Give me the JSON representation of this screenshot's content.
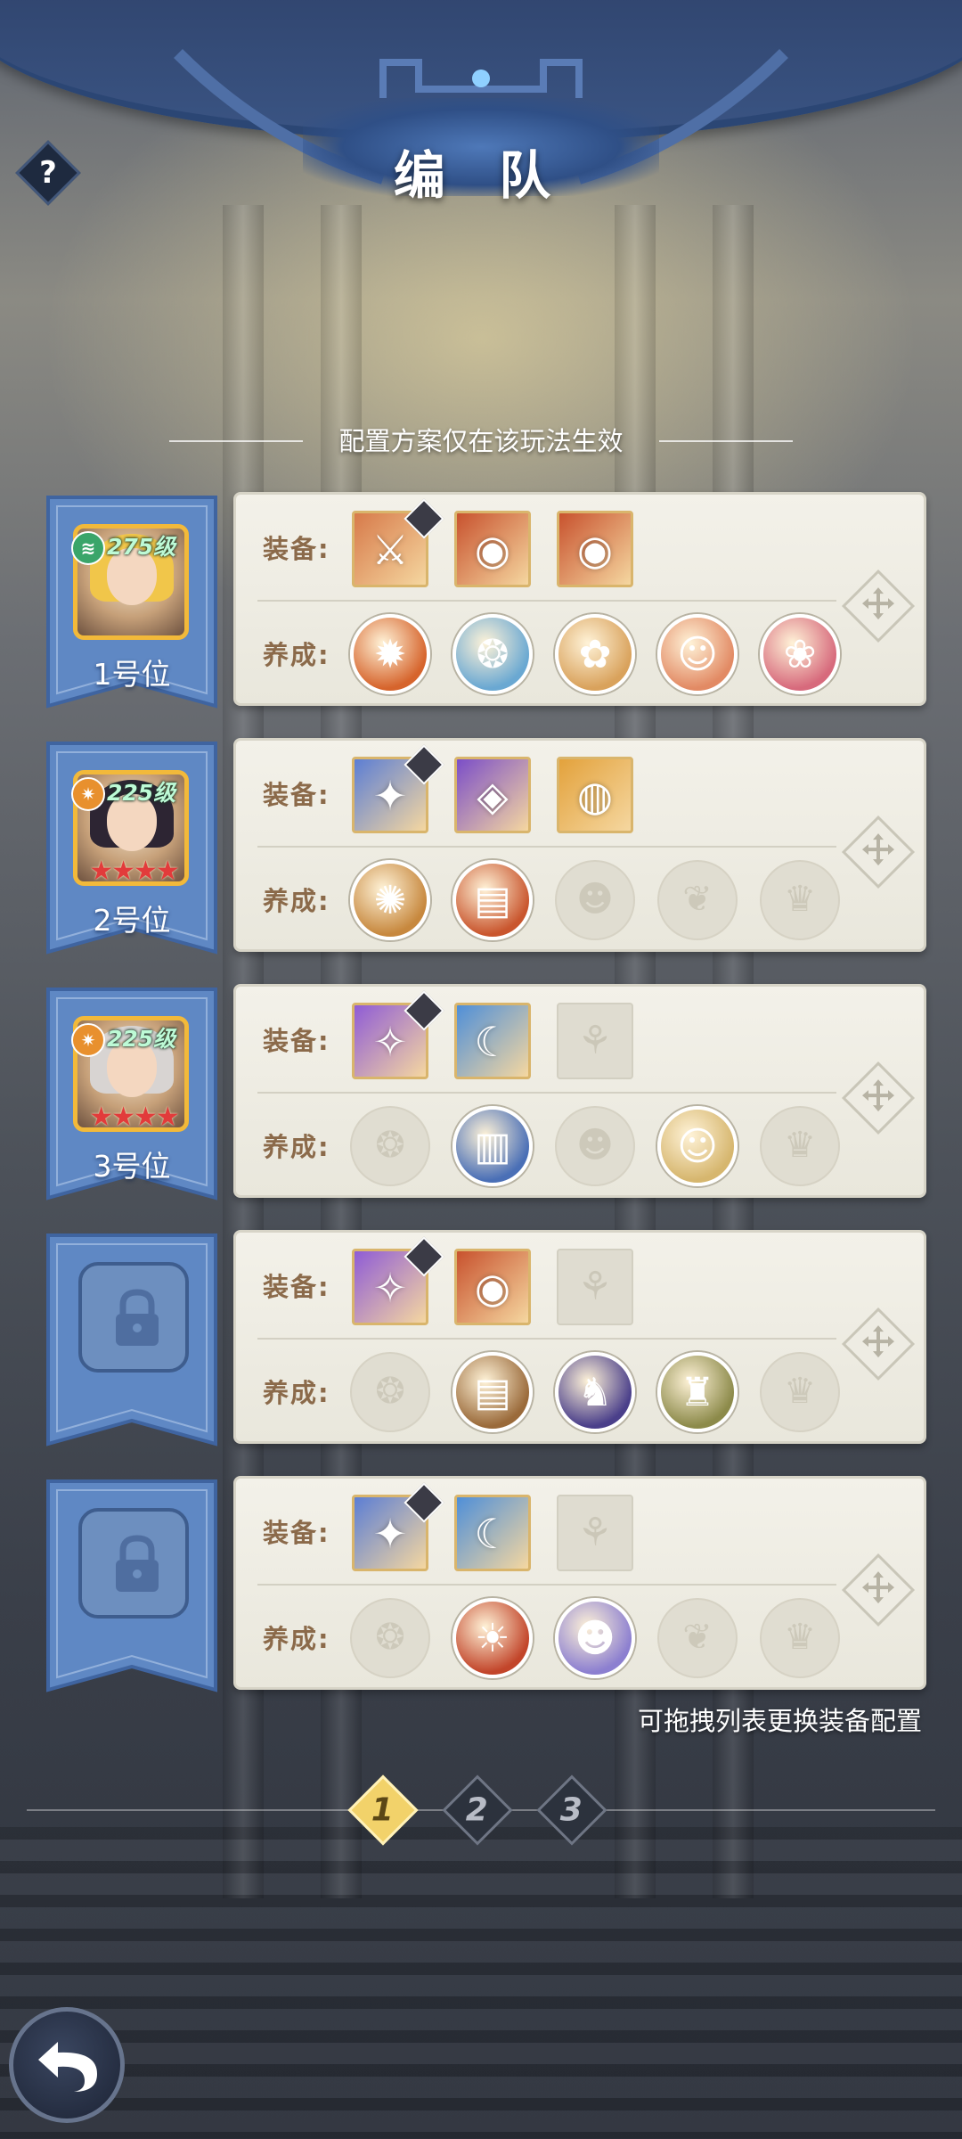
{
  "header": {
    "title": "编 队",
    "help_label": "?"
  },
  "notice": "配置方案仅在该玩法生效",
  "labels": {
    "equip": "装备:",
    "train": "养成:"
  },
  "rows": [
    {
      "slot_label": "1号位",
      "locked": false,
      "level": "275级",
      "level_icon": "green-wing-icon",
      "stars": "",
      "portrait_hair": "#f1c64a",
      "equip": [
        {
          "state": "filled",
          "icon": "golden-sword-icon",
          "glyph": "⚔",
          "color": "#d77a4a",
          "weapon": true
        },
        {
          "state": "filled",
          "icon": "red-amulet-icon",
          "glyph": "◉",
          "color": "#c8522e",
          "weapon": false
        },
        {
          "state": "filled",
          "icon": "red-amulet-icon",
          "glyph": "◉",
          "color": "#c8522e",
          "weapon": false
        }
      ],
      "train": [
        {
          "state": "filled",
          "icon": "fire-pet-icon",
          "glyph": "✹",
          "color": "#d6642c"
        },
        {
          "state": "filled",
          "icon": "water-pet-icon",
          "glyph": "❂",
          "color": "#6aa8d2"
        },
        {
          "state": "filled",
          "icon": "cat-pet-icon",
          "glyph": "✿",
          "color": "#d9a25c"
        },
        {
          "state": "filled",
          "icon": "orange-hair-girl-icon",
          "glyph": "☺",
          "color": "#e28a64"
        },
        {
          "state": "filled",
          "icon": "pink-spirit-icon",
          "glyph": "❀",
          "color": "#d76a7c"
        }
      ]
    },
    {
      "slot_label": "2号位",
      "locked": false,
      "level": "225级",
      "level_icon": "orange-sun-icon",
      "stars": "★★★★",
      "portrait_hair": "#2d2533",
      "equip": [
        {
          "state": "filled",
          "icon": "crystal-sword-icon",
          "glyph": "✦",
          "color": "#5c7ed4",
          "weapon": true
        },
        {
          "state": "filled",
          "icon": "purple-amulet-icon",
          "glyph": "◈",
          "color": "#7b4ec8",
          "weapon": false
        },
        {
          "state": "filled",
          "icon": "gold-amulet-icon",
          "glyph": "◍",
          "color": "#e3a23c",
          "weapon": false
        }
      ],
      "train": [
        {
          "state": "filled",
          "icon": "rune-disc-icon",
          "glyph": "✺",
          "color": "#c7883e"
        },
        {
          "state": "filled",
          "icon": "book-icon",
          "glyph": "▤",
          "color": "#c9562e"
        },
        {
          "state": "empty",
          "icon": "cat-slot-icon",
          "glyph": "☻",
          "color": ""
        },
        {
          "state": "empty",
          "icon": "flower-slot-icon",
          "glyph": "❦",
          "color": ""
        },
        {
          "state": "empty",
          "icon": "crest-slot-icon",
          "glyph": "♛",
          "color": ""
        }
      ]
    },
    {
      "slot_label": "3号位",
      "locked": false,
      "level": "225级",
      "level_icon": "orange-sun-icon",
      "stars": "★★★★",
      "portrait_hair": "#d8d4d2",
      "equip": [
        {
          "state": "filled",
          "icon": "wing-sword-icon",
          "glyph": "✧",
          "color": "#8f5cd6",
          "weapon": true
        },
        {
          "state": "filled",
          "icon": "moon-amulet-icon",
          "glyph": "☾",
          "color": "#4f8fd8",
          "weapon": false
        },
        {
          "state": "empty",
          "icon": "amulet-slot-icon",
          "glyph": "⚘",
          "color": "",
          "weapon": false
        }
      ],
      "train": [
        {
          "state": "empty",
          "icon": "disc-slot-icon",
          "glyph": "❂",
          "color": ""
        },
        {
          "state": "filled",
          "icon": "blue-book-icon",
          "glyph": "▥",
          "color": "#4a6fb6"
        },
        {
          "state": "empty",
          "icon": "cat-slot-icon",
          "glyph": "☻",
          "color": ""
        },
        {
          "state": "filled",
          "icon": "golden-hair-girl-icon",
          "glyph": "☺",
          "color": "#d6b66e"
        },
        {
          "state": "empty",
          "icon": "crest-slot-icon",
          "glyph": "♛",
          "color": ""
        }
      ]
    },
    {
      "slot_label": "",
      "locked": true,
      "level": "",
      "level_icon": "",
      "stars": "",
      "portrait_hair": "",
      "equip": [
        {
          "state": "filled",
          "icon": "wing-sword-icon",
          "glyph": "✧",
          "color": "#8f5cd6",
          "weapon": true
        },
        {
          "state": "filled",
          "icon": "red-amulet-icon",
          "glyph": "◉",
          "color": "#c8522e",
          "weapon": false
        },
        {
          "state": "empty",
          "icon": "amulet-slot-icon",
          "glyph": "⚘",
          "color": "",
          "weapon": false
        }
      ],
      "train": [
        {
          "state": "empty",
          "icon": "disc-slot-icon",
          "glyph": "❂",
          "color": ""
        },
        {
          "state": "filled",
          "icon": "brown-book-icon",
          "glyph": "▤",
          "color": "#9a6a3a"
        },
        {
          "state": "filled",
          "icon": "dark-knight-icon",
          "glyph": "♞",
          "color": "#4a3f8a"
        },
        {
          "state": "filled",
          "icon": "dragon-icon",
          "glyph": "♜",
          "color": "#8c8a4a"
        },
        {
          "state": "empty",
          "icon": "crest-slot-icon",
          "glyph": "♛",
          "color": ""
        }
      ]
    },
    {
      "slot_label": "",
      "locked": true,
      "level": "",
      "level_icon": "",
      "stars": "",
      "portrait_hair": "",
      "equip": [
        {
          "state": "filled",
          "icon": "crystal-sword-icon",
          "glyph": "✦",
          "color": "#5c7ed4",
          "weapon": true
        },
        {
          "state": "filled",
          "icon": "moon-amulet-icon",
          "glyph": "☾",
          "color": "#4f8fd8",
          "weapon": false
        },
        {
          "state": "empty",
          "icon": "amulet-slot-icon",
          "glyph": "⚘",
          "color": "",
          "weapon": false
        }
      ],
      "train": [
        {
          "state": "empty",
          "icon": "disc-slot-icon",
          "glyph": "❂",
          "color": ""
        },
        {
          "state": "filled",
          "icon": "sun-book-icon",
          "glyph": "☀",
          "color": "#c2452a"
        },
        {
          "state": "filled",
          "icon": "white-cat-icon",
          "glyph": "☻",
          "color": "#8c7fd0"
        },
        {
          "state": "empty",
          "icon": "flower-slot-icon",
          "glyph": "❦",
          "color": ""
        },
        {
          "state": "empty",
          "icon": "crest-slot-icon",
          "glyph": "♛",
          "color": ""
        }
      ]
    }
  ],
  "hint": "可拖拽列表更换装备配置",
  "pagination": {
    "pages": [
      "1",
      "2",
      "3"
    ],
    "active": "1"
  },
  "colors": {
    "accent": "#f2d26a",
    "banner": "#5f88c4",
    "panel": "#f0eee5",
    "label": "#8b6a4a"
  }
}
